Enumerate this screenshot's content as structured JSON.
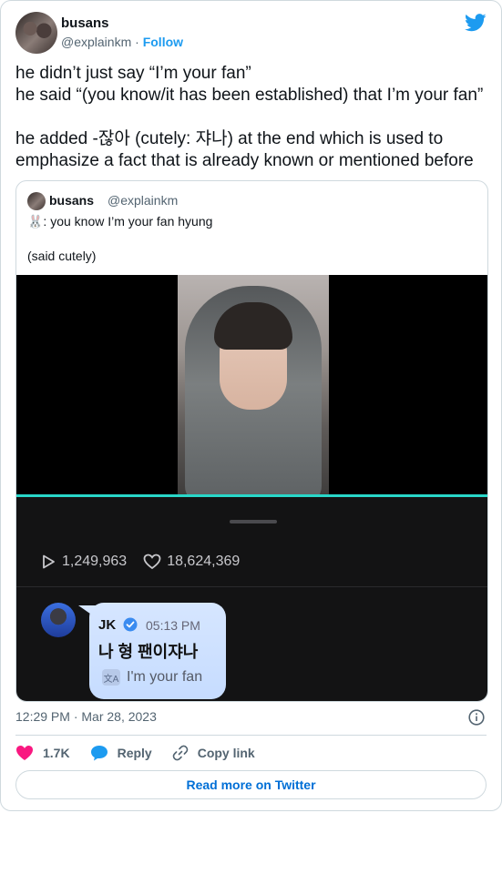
{
  "author": {
    "name": "busans",
    "handle": "@explainkm",
    "separator": "·",
    "follow": "Follow"
  },
  "tweet": {
    "lines": [
      "he didn’t just say “I’m your fan”",
      "he said “(you know/it has been established) that I’m your fan”",
      "",
      "he added -잖아 (cutely: 쟈나) at the end which is used to emphasize a fact that is already known or mentioned before"
    ]
  },
  "quote": {
    "name": "busans",
    "handle": "@explainkm",
    "line1": "🐰: you know I’m your fan hyung",
    "line2": "(said cutely)"
  },
  "media": {
    "views": "1,249,963",
    "likes": "18,624,369",
    "chat": {
      "sender": "JK",
      "time": "05:13 PM",
      "message": "나 형 팬이쟈나",
      "translation_icon": "文A",
      "translation": "I'm your fan"
    }
  },
  "meta": {
    "timestamp": "12:29 PM · Mar 28, 2023"
  },
  "actions": {
    "likes": "1.7K",
    "reply": "Reply",
    "copy": "Copy link"
  },
  "read_more": "Read more on Twitter",
  "colors": {
    "twitter_blue": "#1d9bf0",
    "heart": "#f91880",
    "progress": "#29d7c9"
  }
}
